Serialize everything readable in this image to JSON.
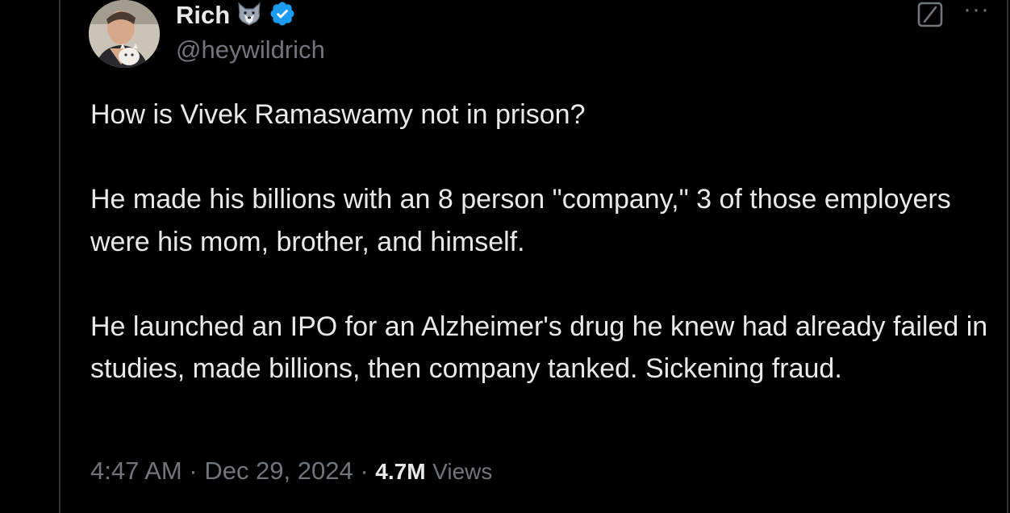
{
  "author": {
    "display_name": "Rich",
    "handle": "@heywildrich",
    "emoji": "wolf-emoji",
    "verified": true,
    "verified_color": "#1d9bf0"
  },
  "tweet": {
    "paragraphs": [
      "How is Vivek Ramaswamy not in prison?",
      "He made his billions with an 8 person \"company,\" 3 of those employers were his mom, brother, and himself.",
      "He launched an IPO for an Alzheimer's drug he knew had already failed in studies, made billions, then company tanked. Sickening fraud."
    ]
  },
  "meta": {
    "time": "4:47 AM",
    "separator": " · ",
    "date": "Dec 29, 2024",
    "views_count": "4.7M",
    "views_label": "Views"
  },
  "actions": {
    "grok_icon": "grok-icon",
    "more_icon": "more-icon",
    "more_glyph": "···"
  },
  "colors": {
    "background": "#000000",
    "text_primary": "#e7e9ea",
    "text_secondary": "#71767b",
    "border": "#2f3336"
  }
}
